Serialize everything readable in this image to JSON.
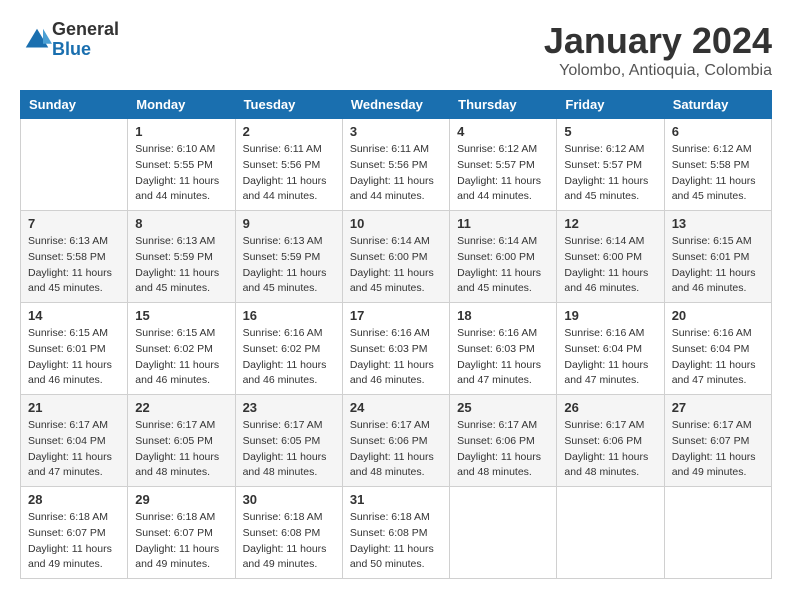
{
  "header": {
    "logo_general": "General",
    "logo_blue": "Blue",
    "month_year": "January 2024",
    "location": "Yolombo, Antioquia, Colombia"
  },
  "weekdays": [
    "Sunday",
    "Monday",
    "Tuesday",
    "Wednesday",
    "Thursday",
    "Friday",
    "Saturday"
  ],
  "weeks": [
    [
      {
        "day": "",
        "info": ""
      },
      {
        "day": "1",
        "info": "Sunrise: 6:10 AM\nSunset: 5:55 PM\nDaylight: 11 hours\nand 44 minutes."
      },
      {
        "day": "2",
        "info": "Sunrise: 6:11 AM\nSunset: 5:56 PM\nDaylight: 11 hours\nand 44 minutes."
      },
      {
        "day": "3",
        "info": "Sunrise: 6:11 AM\nSunset: 5:56 PM\nDaylight: 11 hours\nand 44 minutes."
      },
      {
        "day": "4",
        "info": "Sunrise: 6:12 AM\nSunset: 5:57 PM\nDaylight: 11 hours\nand 44 minutes."
      },
      {
        "day": "5",
        "info": "Sunrise: 6:12 AM\nSunset: 5:57 PM\nDaylight: 11 hours\nand 45 minutes."
      },
      {
        "day": "6",
        "info": "Sunrise: 6:12 AM\nSunset: 5:58 PM\nDaylight: 11 hours\nand 45 minutes."
      }
    ],
    [
      {
        "day": "7",
        "info": "Sunrise: 6:13 AM\nSunset: 5:58 PM\nDaylight: 11 hours\nand 45 minutes."
      },
      {
        "day": "8",
        "info": "Sunrise: 6:13 AM\nSunset: 5:59 PM\nDaylight: 11 hours\nand 45 minutes."
      },
      {
        "day": "9",
        "info": "Sunrise: 6:13 AM\nSunset: 5:59 PM\nDaylight: 11 hours\nand 45 minutes."
      },
      {
        "day": "10",
        "info": "Sunrise: 6:14 AM\nSunset: 6:00 PM\nDaylight: 11 hours\nand 45 minutes."
      },
      {
        "day": "11",
        "info": "Sunrise: 6:14 AM\nSunset: 6:00 PM\nDaylight: 11 hours\nand 45 minutes."
      },
      {
        "day": "12",
        "info": "Sunrise: 6:14 AM\nSunset: 6:00 PM\nDaylight: 11 hours\nand 46 minutes."
      },
      {
        "day": "13",
        "info": "Sunrise: 6:15 AM\nSunset: 6:01 PM\nDaylight: 11 hours\nand 46 minutes."
      }
    ],
    [
      {
        "day": "14",
        "info": "Sunrise: 6:15 AM\nSunset: 6:01 PM\nDaylight: 11 hours\nand 46 minutes."
      },
      {
        "day": "15",
        "info": "Sunrise: 6:15 AM\nSunset: 6:02 PM\nDaylight: 11 hours\nand 46 minutes."
      },
      {
        "day": "16",
        "info": "Sunrise: 6:16 AM\nSunset: 6:02 PM\nDaylight: 11 hours\nand 46 minutes."
      },
      {
        "day": "17",
        "info": "Sunrise: 6:16 AM\nSunset: 6:03 PM\nDaylight: 11 hours\nand 46 minutes."
      },
      {
        "day": "18",
        "info": "Sunrise: 6:16 AM\nSunset: 6:03 PM\nDaylight: 11 hours\nand 47 minutes."
      },
      {
        "day": "19",
        "info": "Sunrise: 6:16 AM\nSunset: 6:04 PM\nDaylight: 11 hours\nand 47 minutes."
      },
      {
        "day": "20",
        "info": "Sunrise: 6:16 AM\nSunset: 6:04 PM\nDaylight: 11 hours\nand 47 minutes."
      }
    ],
    [
      {
        "day": "21",
        "info": "Sunrise: 6:17 AM\nSunset: 6:04 PM\nDaylight: 11 hours\nand 47 minutes."
      },
      {
        "day": "22",
        "info": "Sunrise: 6:17 AM\nSunset: 6:05 PM\nDaylight: 11 hours\nand 48 minutes."
      },
      {
        "day": "23",
        "info": "Sunrise: 6:17 AM\nSunset: 6:05 PM\nDaylight: 11 hours\nand 48 minutes."
      },
      {
        "day": "24",
        "info": "Sunrise: 6:17 AM\nSunset: 6:06 PM\nDaylight: 11 hours\nand 48 minutes."
      },
      {
        "day": "25",
        "info": "Sunrise: 6:17 AM\nSunset: 6:06 PM\nDaylight: 11 hours\nand 48 minutes."
      },
      {
        "day": "26",
        "info": "Sunrise: 6:17 AM\nSunset: 6:06 PM\nDaylight: 11 hours\nand 48 minutes."
      },
      {
        "day": "27",
        "info": "Sunrise: 6:17 AM\nSunset: 6:07 PM\nDaylight: 11 hours\nand 49 minutes."
      }
    ],
    [
      {
        "day": "28",
        "info": "Sunrise: 6:18 AM\nSunset: 6:07 PM\nDaylight: 11 hours\nand 49 minutes."
      },
      {
        "day": "29",
        "info": "Sunrise: 6:18 AM\nSunset: 6:07 PM\nDaylight: 11 hours\nand 49 minutes."
      },
      {
        "day": "30",
        "info": "Sunrise: 6:18 AM\nSunset: 6:08 PM\nDaylight: 11 hours\nand 49 minutes."
      },
      {
        "day": "31",
        "info": "Sunrise: 6:18 AM\nSunset: 6:08 PM\nDaylight: 11 hours\nand 50 minutes."
      },
      {
        "day": "",
        "info": ""
      },
      {
        "day": "",
        "info": ""
      },
      {
        "day": "",
        "info": ""
      }
    ]
  ]
}
